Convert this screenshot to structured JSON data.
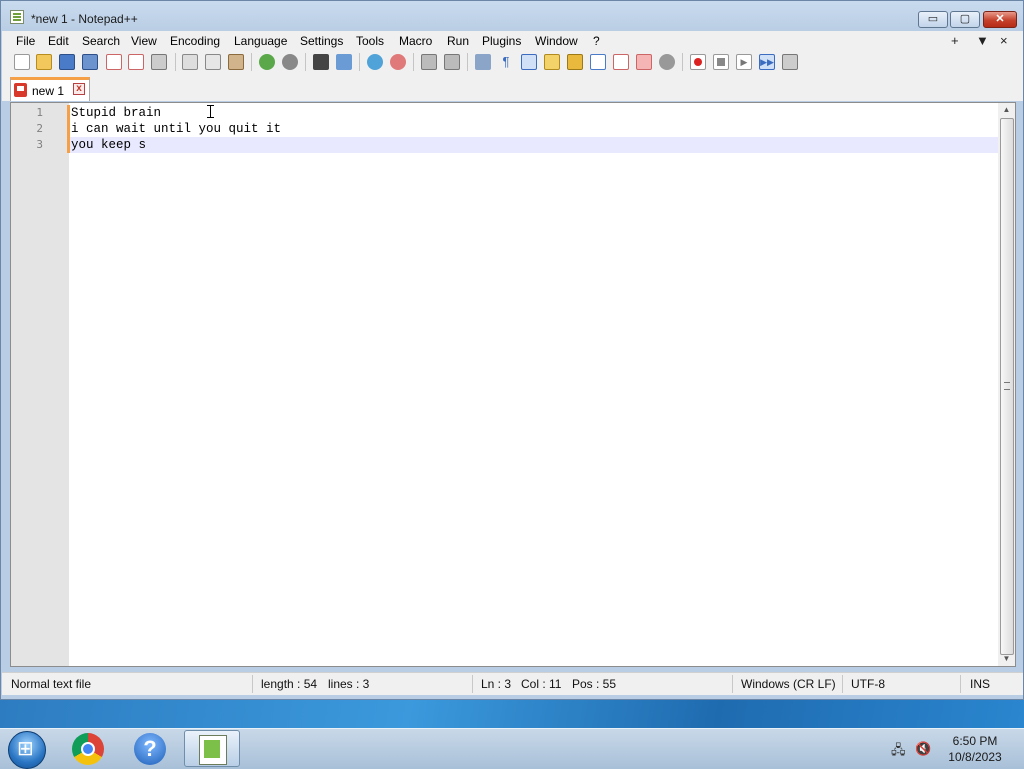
{
  "window": {
    "title": "*new 1 - Notepad++"
  },
  "window_controls": {
    "minimize": "▭",
    "maximize": "▢",
    "close": "✕"
  },
  "menu": {
    "items": [
      "File",
      "Edit",
      "Search",
      "View",
      "Encoding",
      "Language",
      "Settings",
      "Tools",
      "Macro",
      "Run",
      "Plugins",
      "Window",
      "?"
    ],
    "right": [
      "+",
      "▼",
      "×"
    ]
  },
  "toolbar": {
    "icons": [
      "new-file",
      "open-file",
      "save",
      "save-all",
      "close",
      "close-all",
      "print",
      "cut",
      "copy",
      "paste",
      "undo",
      "redo",
      "find",
      "replace",
      "zoom-in",
      "zoom-out",
      "sync-vertical",
      "sync-horizontal",
      "word-wrap",
      "show-all-characters",
      "indent-guide",
      "define-language",
      "document-map",
      "function-list",
      "folder-as-workspace",
      "monitoring",
      "record-macro",
      "stop-macro",
      "play-macro",
      "run-macro-multiple",
      "save-macro"
    ]
  },
  "tab": {
    "label": "new 1",
    "close": "x"
  },
  "editor": {
    "line_numbers": [
      "1",
      "2",
      "3"
    ],
    "lines": [
      "Stupid brain",
      "i can wait until you quit it",
      "you keep s"
    ]
  },
  "status": {
    "file_type": "Normal text file",
    "length": "length : 54",
    "lines": "lines : 3",
    "ln": "Ln : 3",
    "col": "Col : 11",
    "pos": "Pos : 55",
    "eol": "Windows (CR LF)",
    "encoding": "UTF-8",
    "mode": "INS"
  },
  "taskbar": {
    "clock_time": "6:50 PM",
    "clock_date": "10/8/2023",
    "help_glyph": "?"
  },
  "colors": {
    "accent_orange": "#f5a047",
    "current_line": "#e8e8ff",
    "gutter": "#e4e4e4"
  }
}
